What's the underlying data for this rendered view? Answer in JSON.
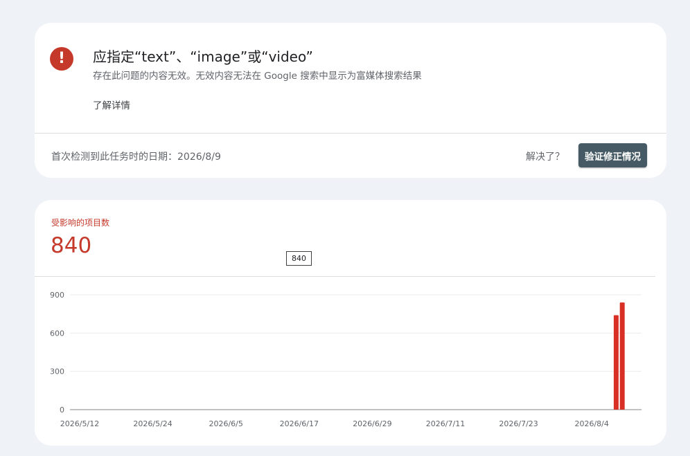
{
  "issue": {
    "title": "应指定“text”、“image”或“video”",
    "description": "存在此问题的内容无效。无效内容无法在 Google 搜索中显示为富媒体搜索结果",
    "learn_more": "了解详情",
    "first_detected": "首次检测到此任务时的日期：2026/8/9",
    "resolved_question": "解决了？",
    "validate_button": "验证修正情况"
  },
  "metric": {
    "label": "受影响的项目数",
    "value": "840",
    "tooltip": "840"
  },
  "colors": {
    "accent": "#c5392a",
    "button": "#455a64",
    "bar": "#d93025"
  },
  "chart_data": {
    "type": "bar",
    "x_ticks": [
      "2026/5/12",
      "2026/5/24",
      "2026/6/5",
      "2026/6/17",
      "2026/6/29",
      "2026/7/11",
      "2026/7/23",
      "2026/8/4"
    ],
    "y_ticks": [
      "900",
      "600",
      "300",
      "0"
    ],
    "ylim": [
      0,
      900
    ],
    "grid": true,
    "series": [
      {
        "values": [
          {
            "x": "2026/8/8",
            "y": 740
          },
          {
            "x": "2026/8/9",
            "y": 840
          }
        ]
      }
    ]
  }
}
